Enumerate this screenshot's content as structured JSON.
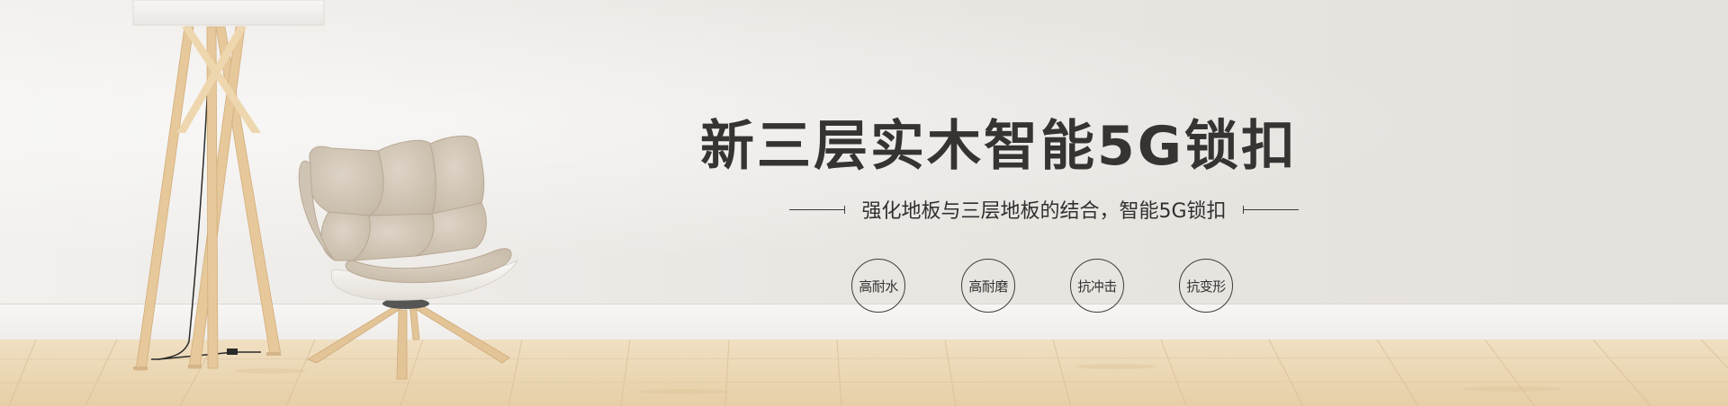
{
  "banner": {
    "headline": "新三层实木智能5G锁扣",
    "subline": "强化地板与三层地板的结合，智能5G锁扣",
    "features": [
      {
        "label": "高耐水"
      },
      {
        "label": "高耐磨"
      },
      {
        "label": "抗冲击"
      },
      {
        "label": "抗变形"
      }
    ]
  },
  "icons": {
    "lamp": "floor-lamp-icon",
    "chair": "lounge-chair-icon"
  },
  "colors": {
    "wall": "#ebe8e4",
    "floor": "#ecd7b4",
    "text": "#353433",
    "wood": "#e8c99c"
  }
}
